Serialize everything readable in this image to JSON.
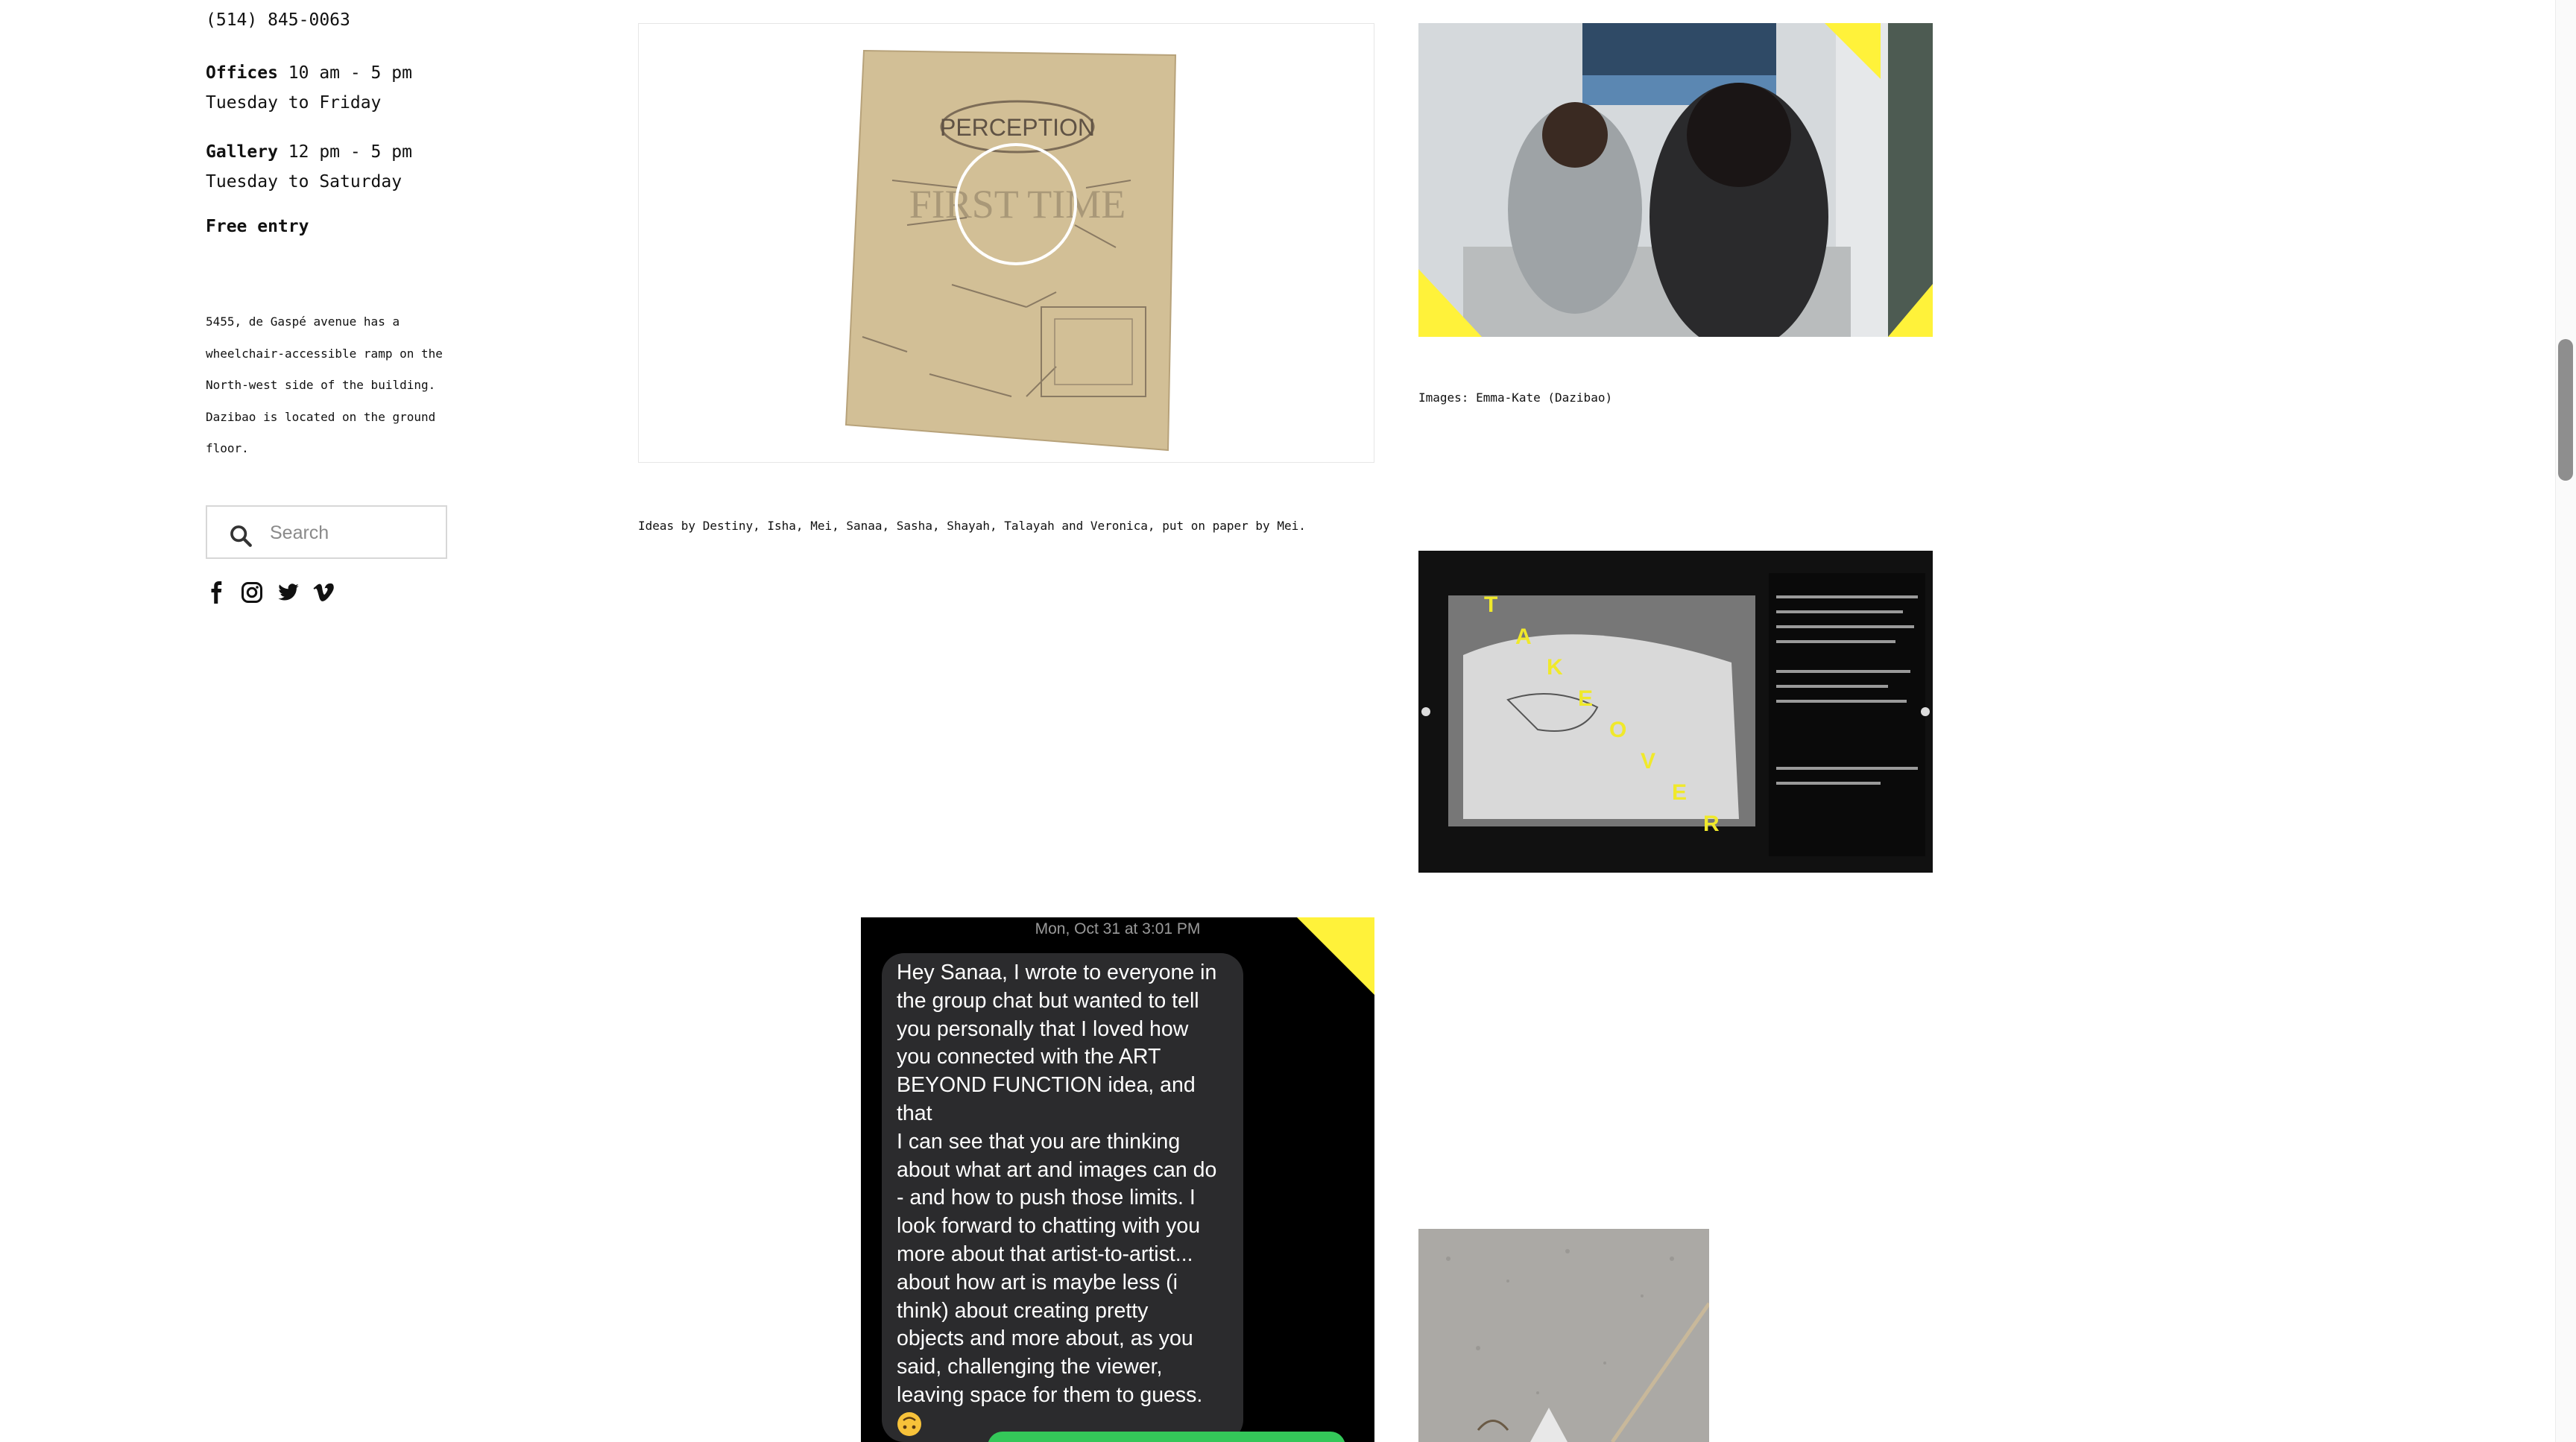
{
  "sidebar": {
    "phone": "(514) 845-0063",
    "offices_label": "Offices",
    "offices_hours": " 10 am - 5 pm",
    "offices_days": "Tuesday to Friday",
    "gallery_label": "Gallery",
    "gallery_hours": " 12 pm - 5 pm",
    "gallery_days": "Tuesday to Saturday",
    "free_entry": "Free entry",
    "access_line1": "5455, de Gaspé avenue has a",
    "access_line2": "wheelchair-accessible ramp on the",
    "access_line3": "North-west side of the building.",
    "access_line4": "Dazibao is located on the ground",
    "access_line5": "floor.",
    "search_placeholder": "Search",
    "social_icons": [
      "facebook-icon",
      "instagram-icon",
      "twitter-icon",
      "vimeo-icon"
    ]
  },
  "content": {
    "drawing": {
      "title": "PERCEPTION",
      "overlay_words": "FIRST TIME",
      "caption": "Ideas by Destiny, Isha, Mei, Sanaa, Sasha, Shayah, Talayah and Veronica, put on paper by Mei."
    },
    "photo_caption": "Images: Emma-Kate (Dazibao)",
    "takeover_letters": [
      "T",
      "A",
      "K",
      "E",
      "O",
      "V",
      "E",
      "R"
    ],
    "message": {
      "date": "Mon, Oct 31 at 3:01 PM",
      "lines": [
        "Hey Sanaa, I wrote to everyone in",
        "the group chat but wanted to tell",
        "you personally that I loved how",
        "you connected with the ART",
        "BEYOND FUNCTION idea, and that",
        "I can see that you are thinking",
        "about what art and images can do",
        "- and how to push those limits. I",
        "look forward to chatting with you",
        "more about that artist-to-artist...",
        "about how art is maybe less (i",
        "think) about creating pretty",
        "objects and more about, as you",
        "said, challenging the viewer,",
        "leaving space for them to guess."
      ]
    }
  },
  "colors": {
    "accent_yellow": "#fff23a",
    "bubble_gray": "#2b2b2d",
    "imessage_green": "#34c759"
  }
}
